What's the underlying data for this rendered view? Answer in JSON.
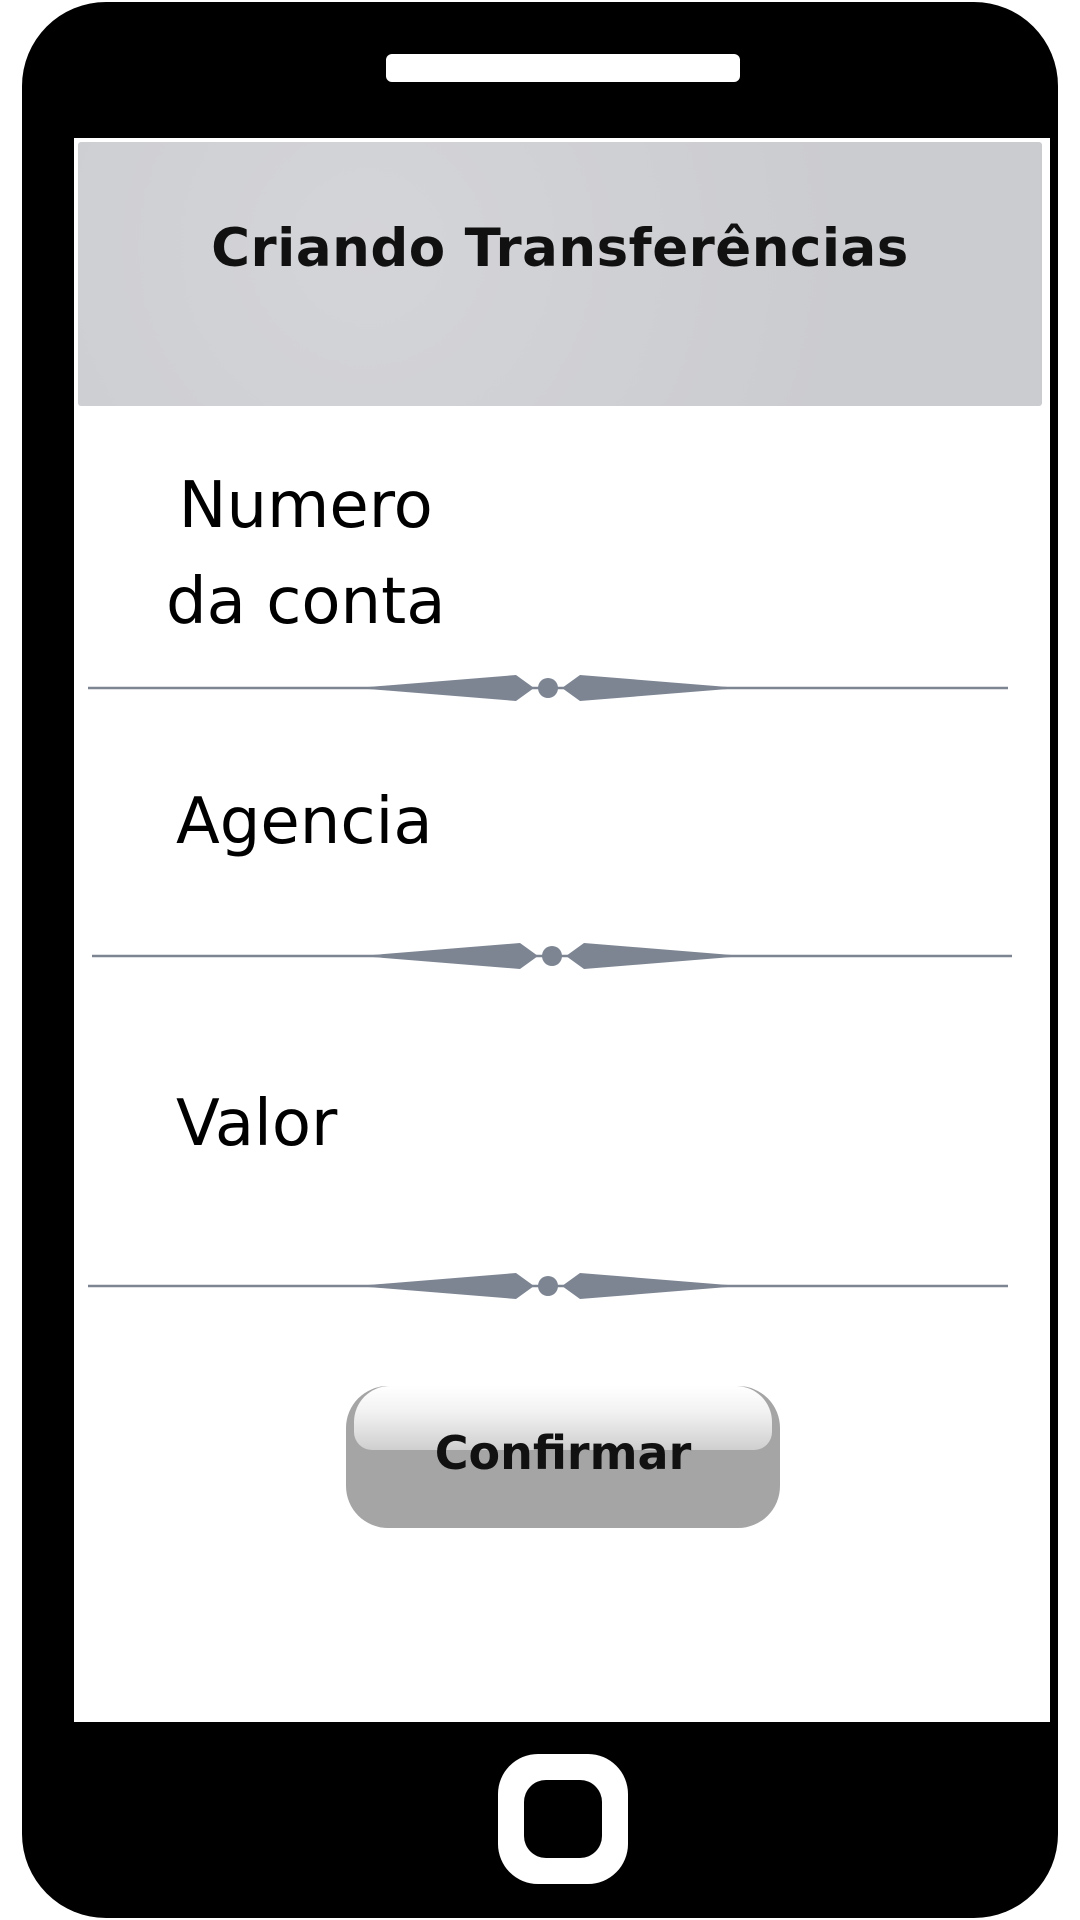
{
  "header": {
    "title": "Criando Transferências"
  },
  "form": {
    "fields": [
      {
        "label": "Numero\nda conta"
      },
      {
        "label": "Agencia"
      },
      {
        "label": "Valor"
      }
    ],
    "confirm_label": "Confirmar"
  },
  "colors": {
    "header_bg": "#cfd0d4",
    "divider": "#7d8593",
    "button_bg": "#a5a5a5",
    "device_body": "#000000"
  },
  "icons": {
    "divider_ornament": "diamond-dot-ornament",
    "home": "home-button-icon"
  }
}
